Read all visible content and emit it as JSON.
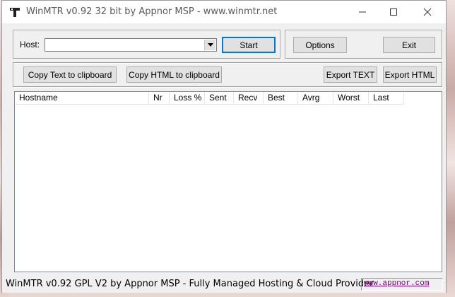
{
  "window": {
    "title": "WinMTR v0.92 32 bit by Appnor MSP - www.winmtr.net",
    "controls": {
      "minimize": "—",
      "maximize": "☐",
      "close": "✕"
    }
  },
  "host_group": {
    "host_label": "Host:",
    "host_value": "",
    "start_button": "Start"
  },
  "options_group": {
    "options_button": "Options",
    "exit_button": "Exit"
  },
  "export_group": {
    "copy_text_button": "Copy Text to clipboard",
    "copy_html_button": "Copy HTML to clipboard",
    "export_text_button": "Export TEXT",
    "export_html_button": "Export HTML"
  },
  "table": {
    "columns": [
      "Hostname",
      "Nr",
      "Loss %",
      "Sent",
      "Recv",
      "Best",
      "Avrg",
      "Worst",
      "Last"
    ],
    "rows": []
  },
  "statusbar": {
    "text": "WinMTR v0.92 GPL V2 by Appnor MSP - Fully Managed Hosting & Cloud Provider",
    "link": "www.appnor.com"
  }
}
